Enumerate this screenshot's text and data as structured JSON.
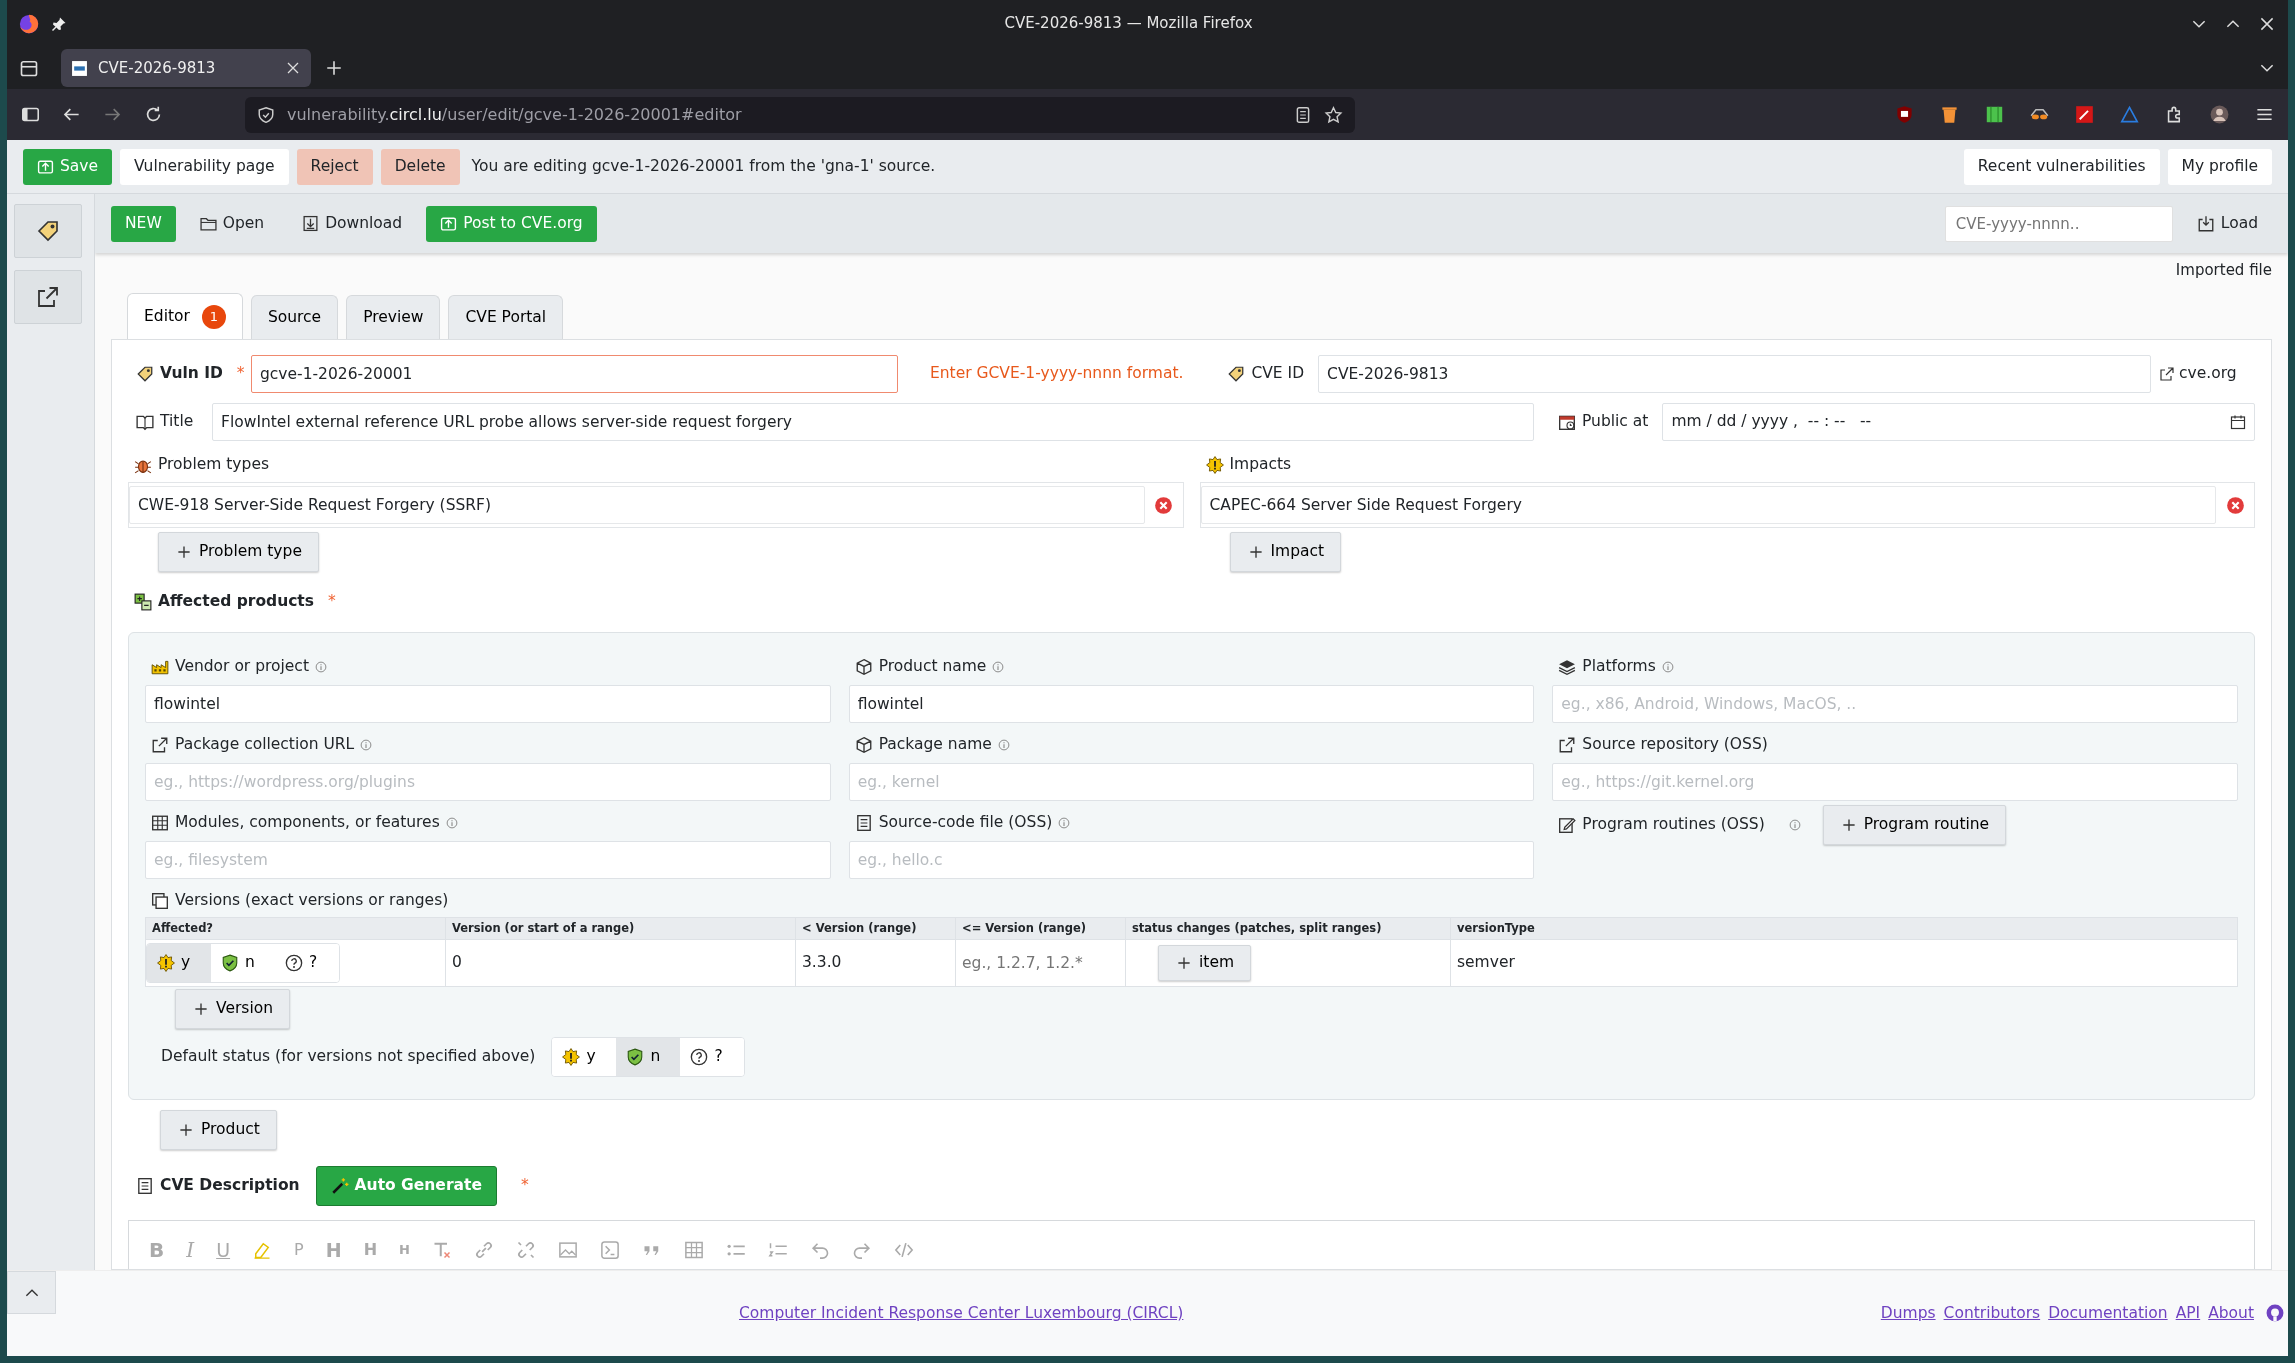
{
  "window": {
    "title": "CVE-2026-9813 — Mozilla Firefox"
  },
  "browser": {
    "tabs": [
      {
        "title": "CVE-2026-9813",
        "selected": true
      }
    ],
    "url": {
      "subdomain": "vulnerability.",
      "domain": "circl.lu",
      "path": "/user/edit/gcve-1-2026-20001#editor"
    }
  },
  "action_bar": {
    "buttons": [
      {
        "label": "Save",
        "kind": "save"
      },
      {
        "label": "Vulnerability page",
        "kind": "light"
      },
      {
        "label": "Reject",
        "kind": "danger"
      },
      {
        "label": "Delete",
        "kind": "danger"
      }
    ],
    "message": "You are editing gcve-1-2026-20001 from the 'gna-1' source.",
    "right_buttons": [
      "Recent vulnerabilities",
      "My profile"
    ]
  },
  "toolbar": {
    "buttons": [
      {
        "label": "NEW",
        "kind": "new"
      },
      {
        "label": "Open",
        "kind": "open"
      },
      {
        "label": "Download",
        "kind": "download"
      },
      {
        "label": "Post to CVE.org",
        "kind": "post"
      }
    ],
    "cve_search": {
      "placeholder": "CVE-yyyy-nnnn.."
    },
    "load": "Load",
    "imported_file": "Imported file"
  },
  "editor_tabs": [
    {
      "label": "Editor",
      "badge": "1",
      "selected": true
    },
    {
      "label": "Source",
      "selected": false
    },
    {
      "label": "Preview",
      "selected": false
    },
    {
      "label": "CVE Portal",
      "selected": false
    }
  ],
  "form": {
    "vuln_id": {
      "label": "Vuln ID",
      "required_mark": "*",
      "value": "gcve-1-2026-20001",
      "error": "Enter GCVE-1-yyyy-nnnn format."
    },
    "cve_id": {
      "label": "CVE ID",
      "value": "CVE-2026-9813",
      "link": "cve.org"
    },
    "title": {
      "label": "Title",
      "value": "FlowIntel external reference URL probe allows server-side request forgery"
    },
    "public_at": {
      "label": "Public at",
      "placeholder": "mm / dd / yyyy ,  -- : --   --"
    },
    "problem_types": {
      "label": "Problem types",
      "items": [
        "CWE-918 Server-Side Request Forgery (SSRF)"
      ],
      "add": "Problem type"
    },
    "impacts": {
      "label": "Impacts",
      "items": [
        "CAPEC-664 Server Side Request Forgery"
      ],
      "add": "Impact"
    },
    "affected_products": {
      "label": "Affected products",
      "required_mark": "*",
      "add": "Product",
      "products": [
        {
          "fields": [
            {
              "kind": "vendor",
              "label": "Vendor or project",
              "info": true,
              "value": "flowintel"
            },
            {
              "kind": "product",
              "label": "Product name",
              "info": true,
              "value": "flowintel"
            },
            {
              "kind": "platforms",
              "label": "Platforms",
              "info": true,
              "placeholder": "eg., x86, Android, Windows, MacOS, .."
            },
            {
              "kind": "package-url",
              "label": "Package collection URL",
              "info": true,
              "placeholder": "eg., https://wordpress.org/plugins"
            },
            {
              "kind": "package",
              "label": "Package name",
              "info": true,
              "placeholder": "eg., kernel"
            },
            {
              "kind": "repo",
              "label": "Source repository (OSS)",
              "info": false,
              "placeholder": "eg., https://git.kernel.org"
            },
            {
              "kind": "modules",
              "label": "Modules, components, or features",
              "info": true,
              "placeholder": "eg., filesystem"
            },
            {
              "kind": "source-file",
              "label": "Source-code file (OSS)",
              "info": true,
              "placeholder": "eg., hello.c"
            },
            {
              "kind": "routines",
              "label": "Program routines (OSS)",
              "info": true,
              "add": "Program routine"
            }
          ],
          "versions": {
            "label": "Versions (exact versions or ranges)",
            "columns": [
              "Affected?",
              "Version (or start of a range)",
              "< Version (range)",
              "<= Version (range)",
              "status changes (patches, split ranges)",
              "versionType"
            ],
            "rows": [
              {
                "status": [
                  {
                    "kind": "affected",
                    "label": "y",
                    "selected": true
                  },
                  {
                    "kind": "unaffected",
                    "label": "n",
                    "selected": false
                  },
                  {
                    "kind": "unknown",
                    "label": "?",
                    "selected": false
                  }
                ],
                "version": "0",
                "less_than": "3.3.0",
                "less_equal_placeholder": "eg., 1.2.7, 1.2.*",
                "changes_add": "item",
                "version_type": "semver"
              }
            ],
            "add": "Version"
          },
          "default_status": {
            "label": "Default status (for versions not specified above)",
            "options": [
              {
                "kind": "affected",
                "label": "y",
                "selected": false
              },
              {
                "kind": "unaffected",
                "label": "n",
                "selected": true
              },
              {
                "kind": "unknown",
                "label": "?",
                "selected": false
              }
            ]
          }
        }
      ]
    },
    "cve_description": {
      "label": "CVE Description",
      "auto_generate": "Auto Generate",
      "required_mark": "*",
      "editor_tools": [
        {
          "kind": "bold",
          "label": "B"
        },
        {
          "kind": "italic",
          "label": "I"
        },
        {
          "kind": "underline",
          "label": "U"
        },
        {
          "kind": "highlight"
        },
        {
          "kind": "paragraph",
          "label": "P"
        },
        {
          "kind": "h1",
          "label": "H"
        },
        {
          "kind": "h2",
          "label": "H"
        },
        {
          "kind": "h3",
          "label": "H"
        },
        {
          "kind": "clear"
        },
        {
          "kind": "link"
        },
        {
          "kind": "unlink"
        },
        {
          "kind": "image"
        },
        {
          "kind": "code"
        },
        {
          "kind": "quote"
        },
        {
          "kind": "table"
        },
        {
          "kind": "bullets"
        },
        {
          "kind": "numbers"
        },
        {
          "kind": "undo"
        },
        {
          "kind": "redo"
        },
        {
          "kind": "source"
        }
      ]
    }
  },
  "footer": {
    "org_link": "Computer Incident Response Center Luxembourg (CIRCL)",
    "links": [
      "Dumps",
      "Contributors",
      "Documentation",
      "API",
      "About"
    ]
  }
}
